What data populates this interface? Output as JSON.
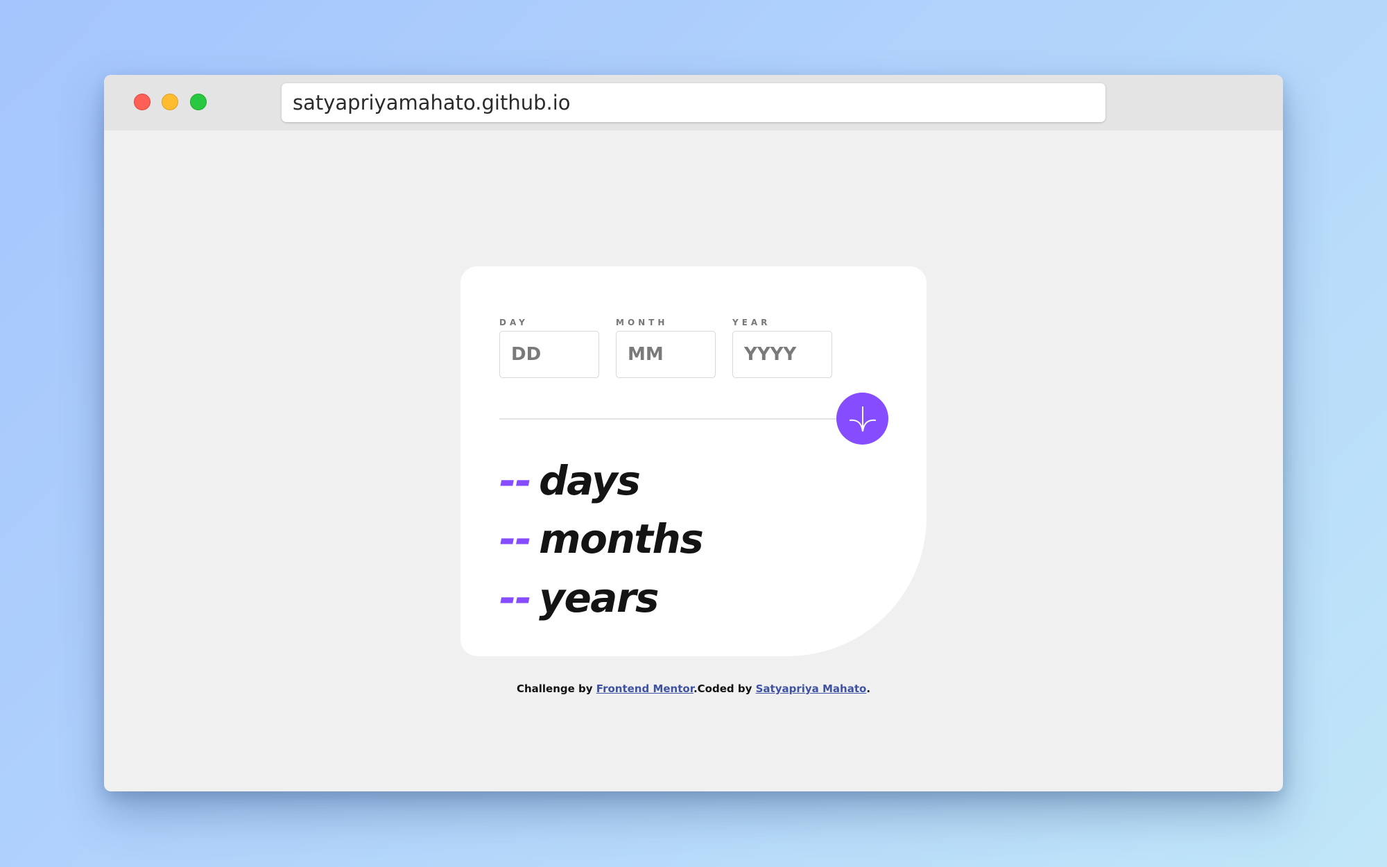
{
  "browser": {
    "url": "satyapriyamahato.github.io",
    "controls": {
      "close_color": "#fe5f57",
      "minimize_color": "#febc2e",
      "maximize_color": "#28c840"
    }
  },
  "form": {
    "day": {
      "label": "DAY",
      "placeholder": "DD",
      "value": ""
    },
    "month": {
      "label": "MONTH",
      "placeholder": "MM",
      "value": ""
    },
    "year": {
      "label": "YEAR",
      "placeholder": "YYYY",
      "value": ""
    },
    "submit_icon": "arrow-down-icon"
  },
  "results": {
    "years": {
      "value": "--",
      "unit": "years"
    },
    "months": {
      "value": "--",
      "unit": "months"
    },
    "days": {
      "value": "--",
      "unit": "days"
    }
  },
  "footer": {
    "prefix": "Challenge by ",
    "challenge_link": "Frontend Mentor",
    "middle": ".Coded by ",
    "author_link": "Satyapriya Mahato",
    "suffix": "."
  },
  "colors": {
    "accent": "#854dff",
    "card_bg": "#ffffff",
    "page_bg": "#f0f0f0",
    "link": "#3e52a3"
  }
}
